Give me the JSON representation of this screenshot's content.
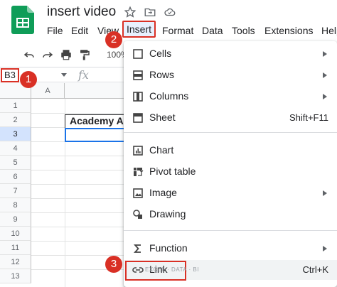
{
  "document": {
    "title": "insert video"
  },
  "menubar": {
    "items": [
      {
        "label": "File"
      },
      {
        "label": "Edit"
      },
      {
        "label": "View"
      },
      {
        "label": "Insert"
      },
      {
        "label": "Format"
      },
      {
        "label": "Data"
      },
      {
        "label": "Tools"
      },
      {
        "label": "Extensions"
      },
      {
        "label": "Help"
      }
    ]
  },
  "toolbar": {
    "zoom": "100%"
  },
  "formula_bar": {
    "name_box": "B3",
    "fx": "fx"
  },
  "grid": {
    "columns": [
      "A"
    ],
    "rows": [
      "1",
      "2",
      "3",
      "4",
      "5",
      "6",
      "7",
      "8",
      "9",
      "10",
      "11",
      "12",
      "13"
    ],
    "selected_row": "3",
    "cell_b2": "Academy A"
  },
  "insert_menu": {
    "items": [
      {
        "label": "Cells",
        "icon": "cells-icon",
        "submenu": true
      },
      {
        "label": "Rows",
        "icon": "rows-icon",
        "submenu": true
      },
      {
        "label": "Columns",
        "icon": "columns-icon",
        "submenu": true
      },
      {
        "label": "Sheet",
        "icon": "sheet-icon",
        "shortcut": "Shift+F11"
      },
      {
        "label": "Chart",
        "icon": "chart-icon"
      },
      {
        "label": "Pivot table",
        "icon": "pivot-table-icon"
      },
      {
        "label": "Image",
        "icon": "image-icon",
        "submenu": true
      },
      {
        "label": "Drawing",
        "icon": "drawing-icon"
      },
      {
        "label": "Function",
        "icon": "sigma-icon",
        "submenu": true
      },
      {
        "label": "Link",
        "icon": "link-icon",
        "shortcut": "Ctrl+K"
      }
    ]
  },
  "watermark": "EXCEL · DATA · BI",
  "step_badges": [
    "1",
    "2",
    "3"
  ],
  "colors": {
    "annotation": "#d93025",
    "selection": "#1a73e8",
    "sheets_green": "#0f9d58"
  }
}
